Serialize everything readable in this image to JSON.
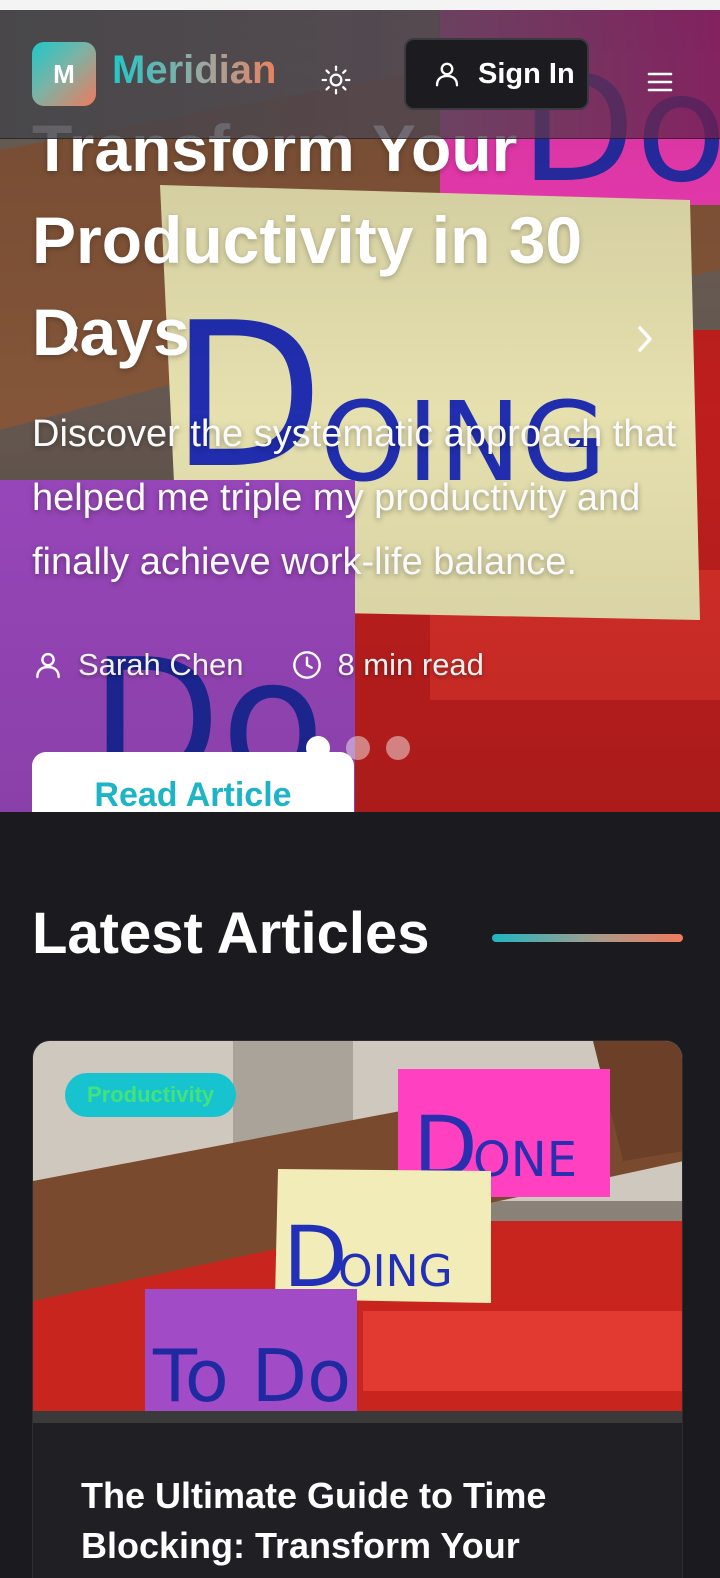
{
  "header": {
    "logo_letter": "M",
    "brand": "Meridian",
    "signin_label": "Sign In"
  },
  "hero": {
    "title": "Transform Your Productivity in 30 Days",
    "subtitle": "Discover the systematic approach that helped me triple my productivity and finally achieve work-life balance.",
    "author": "Sarah Chen",
    "read_time": "8 min read",
    "cta": "Read Article",
    "slides_total": 3,
    "active_slide": 1,
    "sticky_notes": [
      "Done",
      "Doing",
      "To Do"
    ]
  },
  "latest": {
    "title": "Latest Articles",
    "articles": [
      {
        "category": "Productivity",
        "title": "The Ultimate Guide to Time Blocking: Transform Your"
      }
    ]
  },
  "colors": {
    "accent_teal": "#1db5c6",
    "accent_coral": "#f17b5e",
    "background": "#1b1b1f",
    "tag_bg": "#18c3d0",
    "tag_text": "#44e27a"
  }
}
